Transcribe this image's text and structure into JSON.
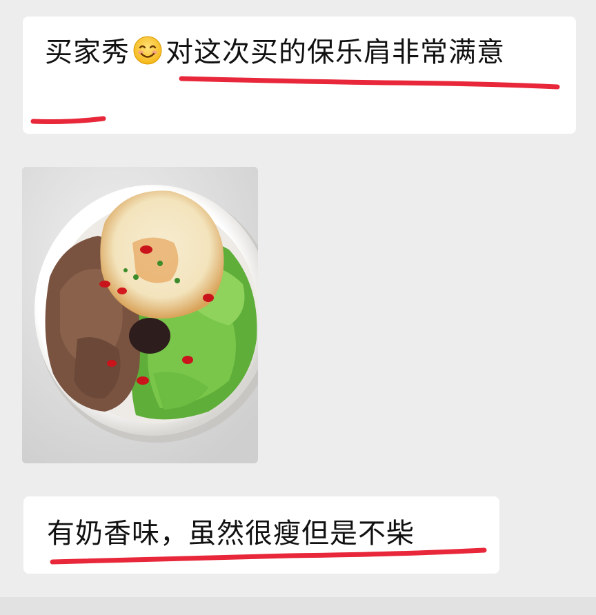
{
  "messages": [
    {
      "text_before": "买家秀",
      "emoji": "smiling-face-emoji",
      "text_after": "对这次买的保乐肩非常满意"
    },
    {
      "image": "food-bowl-photo"
    },
    {
      "text": "有奶香味，虽然很瘦但是不柴"
    }
  ],
  "colors": {
    "background": "#ededed",
    "bubble": "#ffffff",
    "underline": "#e8283a"
  }
}
